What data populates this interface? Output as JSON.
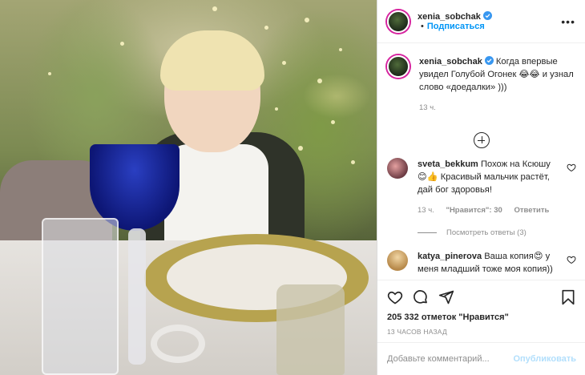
{
  "post": {
    "username": "xenia_sobchak",
    "follow_label": "Подписаться",
    "separator": "•",
    "more_icon": "more-horizontal-icon",
    "photo_alt": "boy-at-dinner-table-photo"
  },
  "caption": {
    "username": "xenia_sobchak",
    "text": "Когда впервые увидел Голубой Огонек 😂😂 и узнал слово «доедалки» )))",
    "time": "13 ч."
  },
  "load_more_icon": "plus-circle-icon",
  "comments": [
    {
      "username": "sveta_bekkum",
      "text": "Похож на Ксюшу 😊👍 Красивый мальчик растёт, дай бог здоровья!",
      "time": "13 ч.",
      "likes": "\"Нравится\": 30",
      "reply_label": "Ответить",
      "view_replies": "Посмотреть ответы (3)"
    },
    {
      "username": "katya_pinerova",
      "text": "Ваша копия😍 у меня младший тоже моя копия))"
    }
  ],
  "actions": {
    "likes_count": "205 332 отметок \"Нравится\"",
    "timestamp": "13 ЧАСОВ НАЗАД"
  },
  "add_comment": {
    "placeholder": "Добавьте комментарий...",
    "publish_label": "Опубликовать"
  },
  "colors": {
    "link_blue": "#0095f6",
    "verified_blue": "#3897f0",
    "muted": "#8e8e8e",
    "publish_disabled": "#b2dffc"
  }
}
